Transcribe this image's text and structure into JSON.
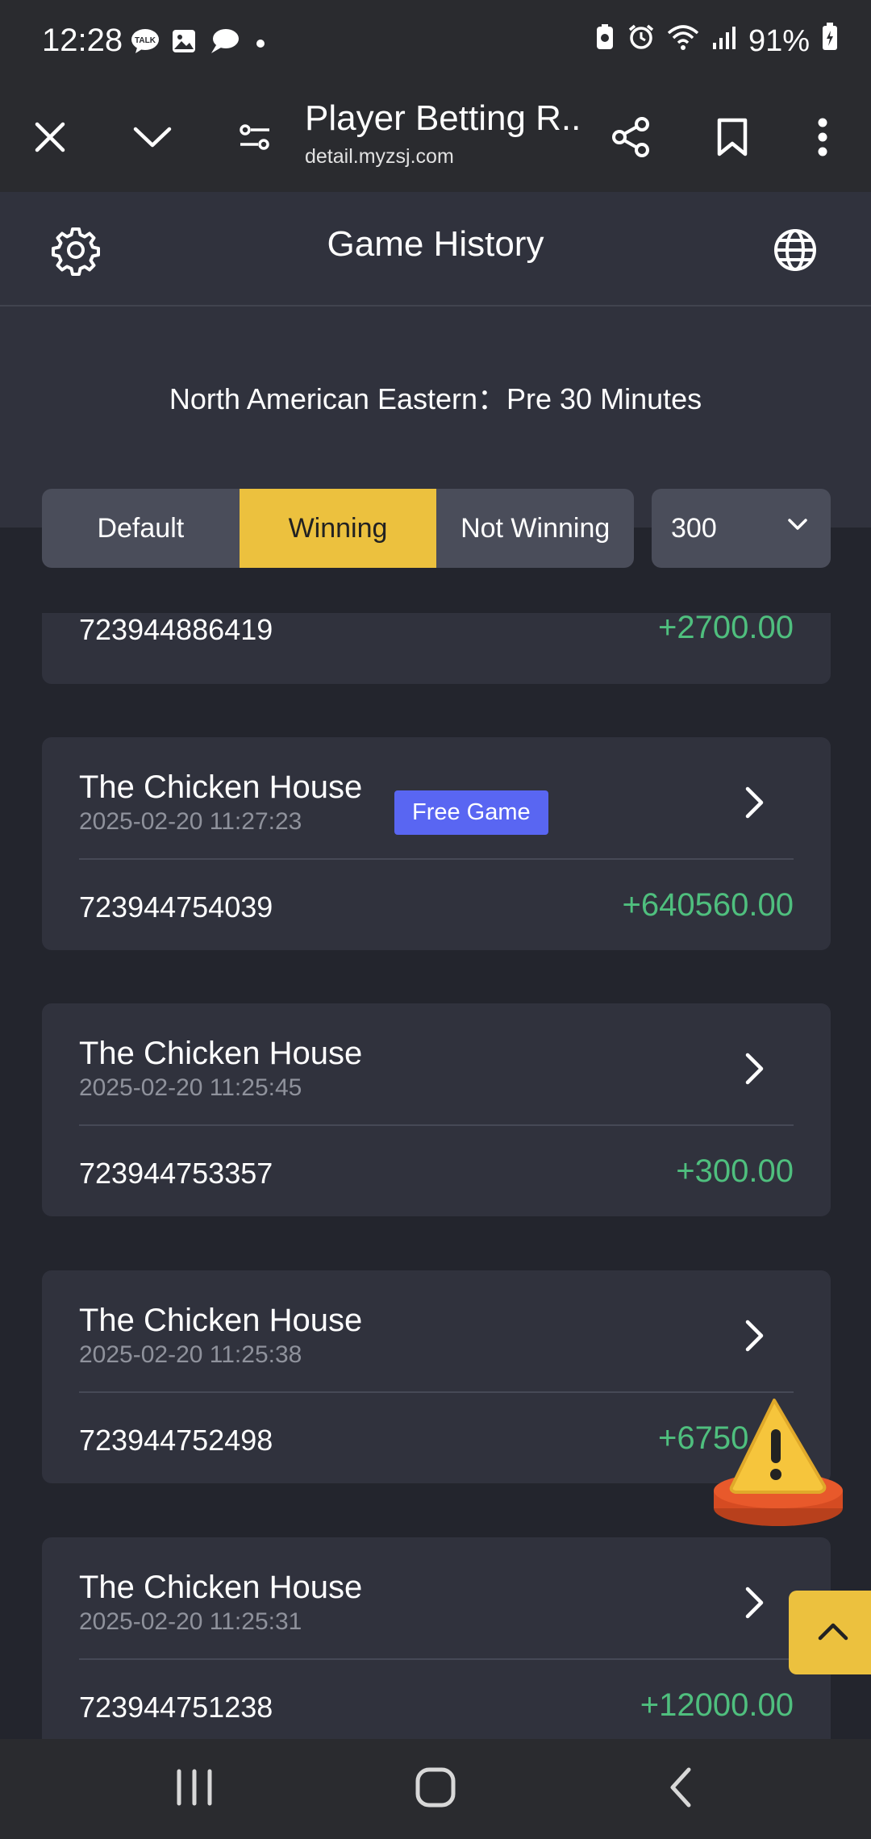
{
  "status_bar": {
    "time": "12:28",
    "battery": "91%",
    "icons": [
      "kakaotalk-icon",
      "gallery-icon",
      "chat-icon",
      "battery-saver-icon",
      "alarm-icon",
      "wifi-icon",
      "signal-icon",
      "battery-icon"
    ]
  },
  "browser": {
    "title": "Player Betting R...",
    "url": "detail.myzsj.com",
    "icons": [
      "close-icon",
      "chevron-down-icon",
      "tune-icon",
      "share-icon",
      "bookmark-icon",
      "more-vert-icon"
    ]
  },
  "header": {
    "title": "Game History",
    "left_icon": "gear-icon",
    "right_icon": "globe-icon"
  },
  "timezone": {
    "label": "North American Eastern：Pre 30 Minutes"
  },
  "filters": {
    "tabs": [
      {
        "label": "Default",
        "active": false
      },
      {
        "label": "Winning",
        "active": true
      },
      {
        "label": "Not Winning",
        "active": false
      }
    ],
    "count_select": "300",
    "active_color": "#ecc13e"
  },
  "records": [
    {
      "id": "723944886419",
      "amount": "+2700.00"
    },
    {
      "game": "The Chicken House",
      "time": "2025-02-20 11:27:23",
      "badge": "Free Game",
      "id": "723944754039",
      "amount": "+640560.00"
    },
    {
      "game": "The Chicken House",
      "time": "2025-02-20 11:25:45",
      "id": "723944753357",
      "amount": "+300.00"
    },
    {
      "game": "The Chicken House",
      "time": "2025-02-20 11:25:38",
      "id": "723944752498",
      "amount": "+6750.00"
    },
    {
      "game": "The Chicken House",
      "time": "2025-02-20 11:25:31",
      "id": "723944751238",
      "amount": "+12000.00"
    }
  ],
  "colors": {
    "win_amount": "#4fbf7e",
    "badge": "#5966f2"
  },
  "nav": [
    "recents-icon",
    "home-icon",
    "back-icon"
  ]
}
